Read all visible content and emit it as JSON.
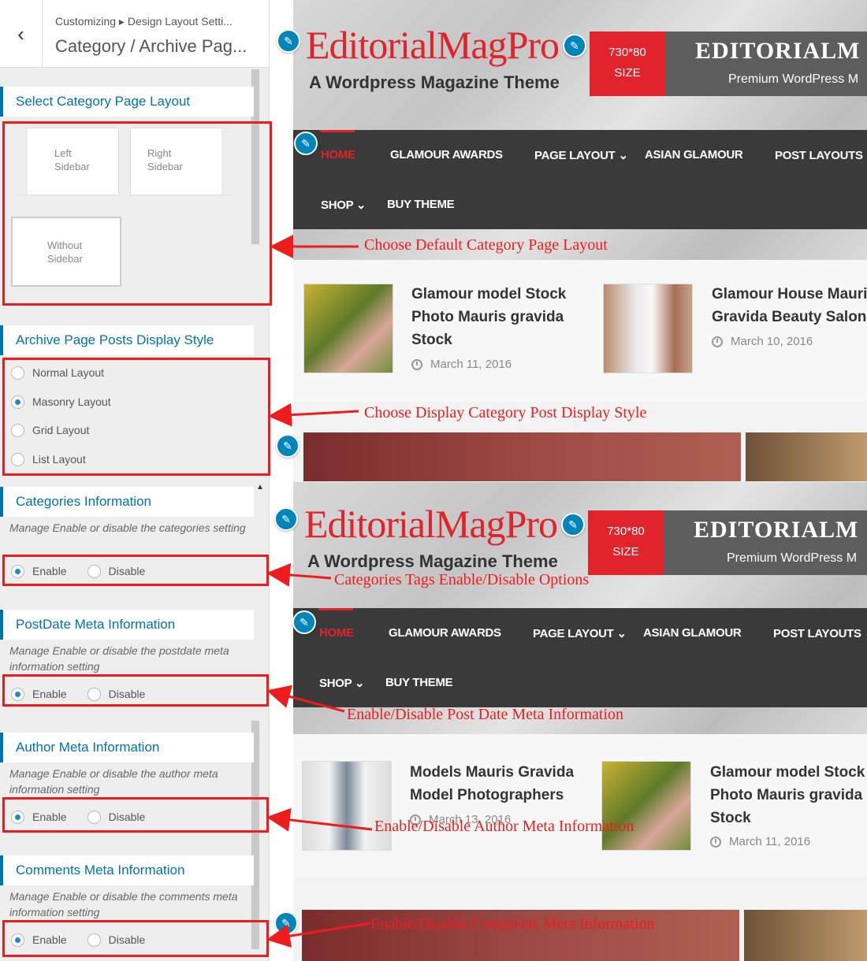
{
  "panel": {
    "back_icon": "back-arrow-icon",
    "breadcrumb": "Customizing ▸ Design Layout Setti...",
    "title": "Category / Archive Pag...",
    "layout_section": {
      "title": "Select Category Page Layout",
      "options": [
        "Left Sidebar",
        "Right Sidebar",
        "Without Sidebar"
      ],
      "selected": "Without Sidebar"
    },
    "display_section": {
      "title": "Archive Page Posts Display Style",
      "options": [
        "Normal Layout",
        "Masonry Layout",
        "Grid Layout",
        "List Layout"
      ],
      "selected": "Masonry Layout"
    },
    "categories": {
      "title": "Categories Information",
      "desc": "Manage Enable or disable the categories setting",
      "enable": "Enable",
      "disable": "Disable"
    },
    "postdate": {
      "title": "PostDate Meta Information",
      "desc": "Manage Enable or disable the postdate meta information setting",
      "enable": "Enable",
      "disable": "Disable"
    },
    "author": {
      "title": "Author Meta Information",
      "desc": "Manage Enable or disable the author meta information setting",
      "enable": "Enable",
      "disable": "Disable"
    },
    "comments": {
      "title": "Comments Meta Information",
      "desc": "Manage Enable or disable the comments meta information setting",
      "enable": "Enable",
      "disable": "Disable"
    }
  },
  "preview": {
    "logo": "EditorialMagPro",
    "tagline": "A Wordpress Magazine Theme",
    "ad_size": "730*80",
    "ad_size_label": "SIZE",
    "ad_brand": "EDITORIALM",
    "ad_sub": "Premium WordPress M",
    "nav": [
      "HOME",
      "GLAMOUR AWARDS",
      "PAGE LAYOUT",
      "ASIAN GLAMOUR",
      "POST LAYOUTS",
      "SHOP",
      "BUY THEME"
    ],
    "posts_top": [
      {
        "title": "Glamour model Stock Photo Mauris gravida Stock",
        "date": "March 11, 2016"
      },
      {
        "title": "Glamour House Mauris Gravida Beauty Salon",
        "date": "March 10, 2016"
      }
    ],
    "posts_bottom": [
      {
        "title": "Models Mauris Gravida Model Photographers",
        "date": "March 13, 2016"
      },
      {
        "title": "Glamour model Stock Photo Mauris gravida Stock",
        "date": "March 11, 2016"
      }
    ]
  },
  "annotations": {
    "a1": "Choose Default Category Page Layout",
    "a2": "Choose Display Category Post Display Style",
    "a3": "Categories Tags Enable/Disable Options",
    "a4": "Enable/Disable Post Date Meta Information",
    "a5": "Enable/Disable Author Meta Information",
    "a6": "Enable/Disable Comments Meta Information"
  },
  "colors": {
    "accent": "#0073aa",
    "brand_red": "#e1232b",
    "annotation_red": "#ee1c1c",
    "nav_bg": "#3a3a3a"
  }
}
